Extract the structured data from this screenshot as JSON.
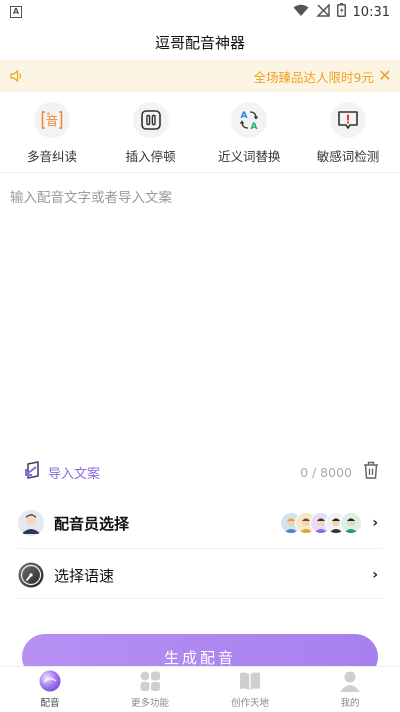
{
  "status_bar": {
    "time": "10:31",
    "left_icon": "A"
  },
  "title": "逗哥配音神器",
  "notice": {
    "text": "全场臻品达人限时9元"
  },
  "tools": [
    {
      "label": "多音纠读",
      "icon": "pronunciation-icon",
      "glyph": "音"
    },
    {
      "label": "插入停顿",
      "icon": "pause-icon"
    },
    {
      "label": "近义词替换",
      "icon": "synonym-icon"
    },
    {
      "label": "敏感词检测",
      "icon": "sensitive-word-icon"
    }
  ],
  "editor": {
    "placeholder": "输入配音文字或者导入文案"
  },
  "import": {
    "label": "导入文案",
    "count": "0 / 8000"
  },
  "voice": {
    "label": "配音员选择"
  },
  "speed": {
    "label": "选择语速"
  },
  "generate_label": "生成配音",
  "nav": [
    {
      "label": "配音",
      "icon": "dubbing-icon",
      "active": true
    },
    {
      "label": "更多功能",
      "icon": "more-functions-icon",
      "active": false
    },
    {
      "label": "创作天地",
      "icon": "creation-book-icon",
      "active": false
    },
    {
      "label": "我的",
      "icon": "profile-icon",
      "active": false
    }
  ],
  "colors": {
    "accent": "#a680ee",
    "notice_text": "#f0a020",
    "notice_bg": "#fdf5e3",
    "tool_orange": "#f08a2c"
  }
}
